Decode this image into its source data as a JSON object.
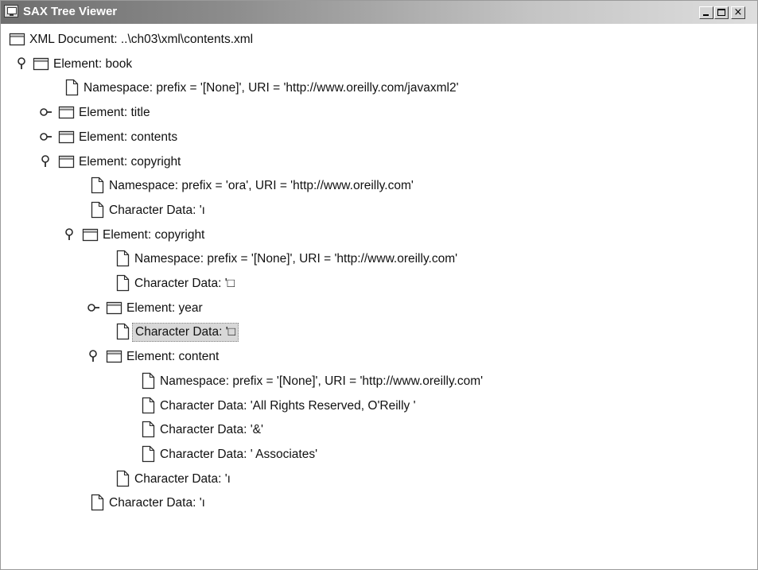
{
  "window": {
    "title": "SAX Tree Viewer",
    "controls": {
      "minimize": "_",
      "maximize": "□",
      "close": "×"
    }
  },
  "tree": {
    "rows": [
      {
        "level": 0,
        "toggle": "none",
        "icon": "folder-icon",
        "label": "XML Document: ..\\ch03\\xml\\contents.xml",
        "selected": false
      },
      {
        "level": 0,
        "toggle": "expanded",
        "icon": "folder-icon",
        "label": "Element: book",
        "selected": false
      },
      {
        "level": 1,
        "toggle": "none",
        "icon": "file-icon",
        "label": "Namespace: prefix = '[None]', URI = 'http://www.oreilly.com/javaxml2'",
        "selected": false
      },
      {
        "level": 1,
        "toggle": "collapsed",
        "icon": "folder-icon",
        "label": "Element: title",
        "selected": false
      },
      {
        "level": 1,
        "toggle": "collapsed",
        "icon": "folder-icon",
        "label": "Element: contents",
        "selected": false
      },
      {
        "level": 1,
        "toggle": "expanded",
        "icon": "folder-icon",
        "label": "Element: copyright",
        "selected": false
      },
      {
        "level": 2,
        "toggle": "none",
        "icon": "file-icon",
        "label": "Namespace: prefix = 'ora', URI = 'http://www.oreilly.com'",
        "selected": false
      },
      {
        "level": 2,
        "toggle": "none",
        "icon": "file-icon",
        "label": "Character Data: 'ı",
        "selected": false
      },
      {
        "level": 2,
        "toggle": "expanded",
        "icon": "folder-icon",
        "label": "Element: copyright",
        "selected": false
      },
      {
        "level": 3,
        "toggle": "none",
        "icon": "file-icon",
        "label": "Namespace: prefix = '[None]', URI = 'http://www.oreilly.com'",
        "selected": false
      },
      {
        "level": 3,
        "toggle": "none",
        "icon": "file-icon",
        "label": "Character Data: '□",
        "selected": false
      },
      {
        "level": 3,
        "toggle": "collapsed",
        "icon": "folder-icon",
        "label": "Element: year",
        "selected": false
      },
      {
        "level": 3,
        "toggle": "none",
        "icon": "file-icon",
        "label": "Character Data: '□",
        "selected": true
      },
      {
        "level": 3,
        "toggle": "expanded",
        "icon": "folder-icon",
        "label": "Element: content",
        "selected": false
      },
      {
        "level": 4,
        "toggle": "none",
        "icon": "file-icon",
        "label": "Namespace: prefix = '[None]', URI = 'http://www.oreilly.com'",
        "selected": false
      },
      {
        "level": 4,
        "toggle": "none",
        "icon": "file-icon",
        "label": "Character Data: 'All Rights Reserved, O'Reilly '",
        "selected": false
      },
      {
        "level": 4,
        "toggle": "none",
        "icon": "file-icon",
        "label": "Character Data: '&'",
        "selected": false
      },
      {
        "level": 4,
        "toggle": "none",
        "icon": "file-icon",
        "label": "Character Data: ' Associates'",
        "selected": false
      },
      {
        "level": 3,
        "toggle": "none",
        "icon": "file-icon",
        "label": "Character Data: 'ı",
        "selected": false
      },
      {
        "level": 2,
        "toggle": "none",
        "icon": "file-icon",
        "label": "Character Data: 'ı",
        "selected": false
      }
    ]
  },
  "colors": {
    "titlebar_start": "#6e6e6e",
    "titlebar_end": "#dedede",
    "selection": "#d8d8d8",
    "text": "#111111"
  }
}
